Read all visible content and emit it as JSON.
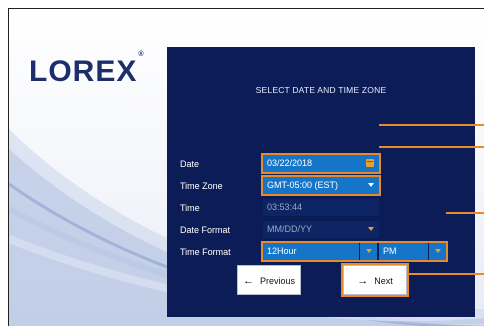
{
  "brand": {
    "logo_text": "LOREX",
    "trademark": "®"
  },
  "dialog": {
    "title": "SELECT DATE AND TIME ZONE",
    "rows": {
      "date": {
        "label": "Date",
        "value": "03/22/2018"
      },
      "time_zone": {
        "label": "Time Zone",
        "value": "GMT-05:00 (EST)"
      },
      "time": {
        "label": "Time",
        "value": "03:53:44"
      },
      "date_format": {
        "label": "Date Format",
        "value": "MM/DD/YY"
      },
      "time_format": {
        "label": "Time Format",
        "hour_mode": "12Hour",
        "meridiem": "PM"
      }
    },
    "buttons": {
      "previous": "Previous",
      "next": "Next"
    }
  },
  "icons": {
    "calendar": "calendar-icon",
    "dropdown": "chevron-down-icon",
    "previous": "arrow-left-icon",
    "next": "arrow-right-icon"
  },
  "colors": {
    "panel": "#0b1c56",
    "field_active": "#1576c9",
    "field_disabled": "#0e2565",
    "highlight": "#e88a2c",
    "logo": "#1c2e6b"
  }
}
